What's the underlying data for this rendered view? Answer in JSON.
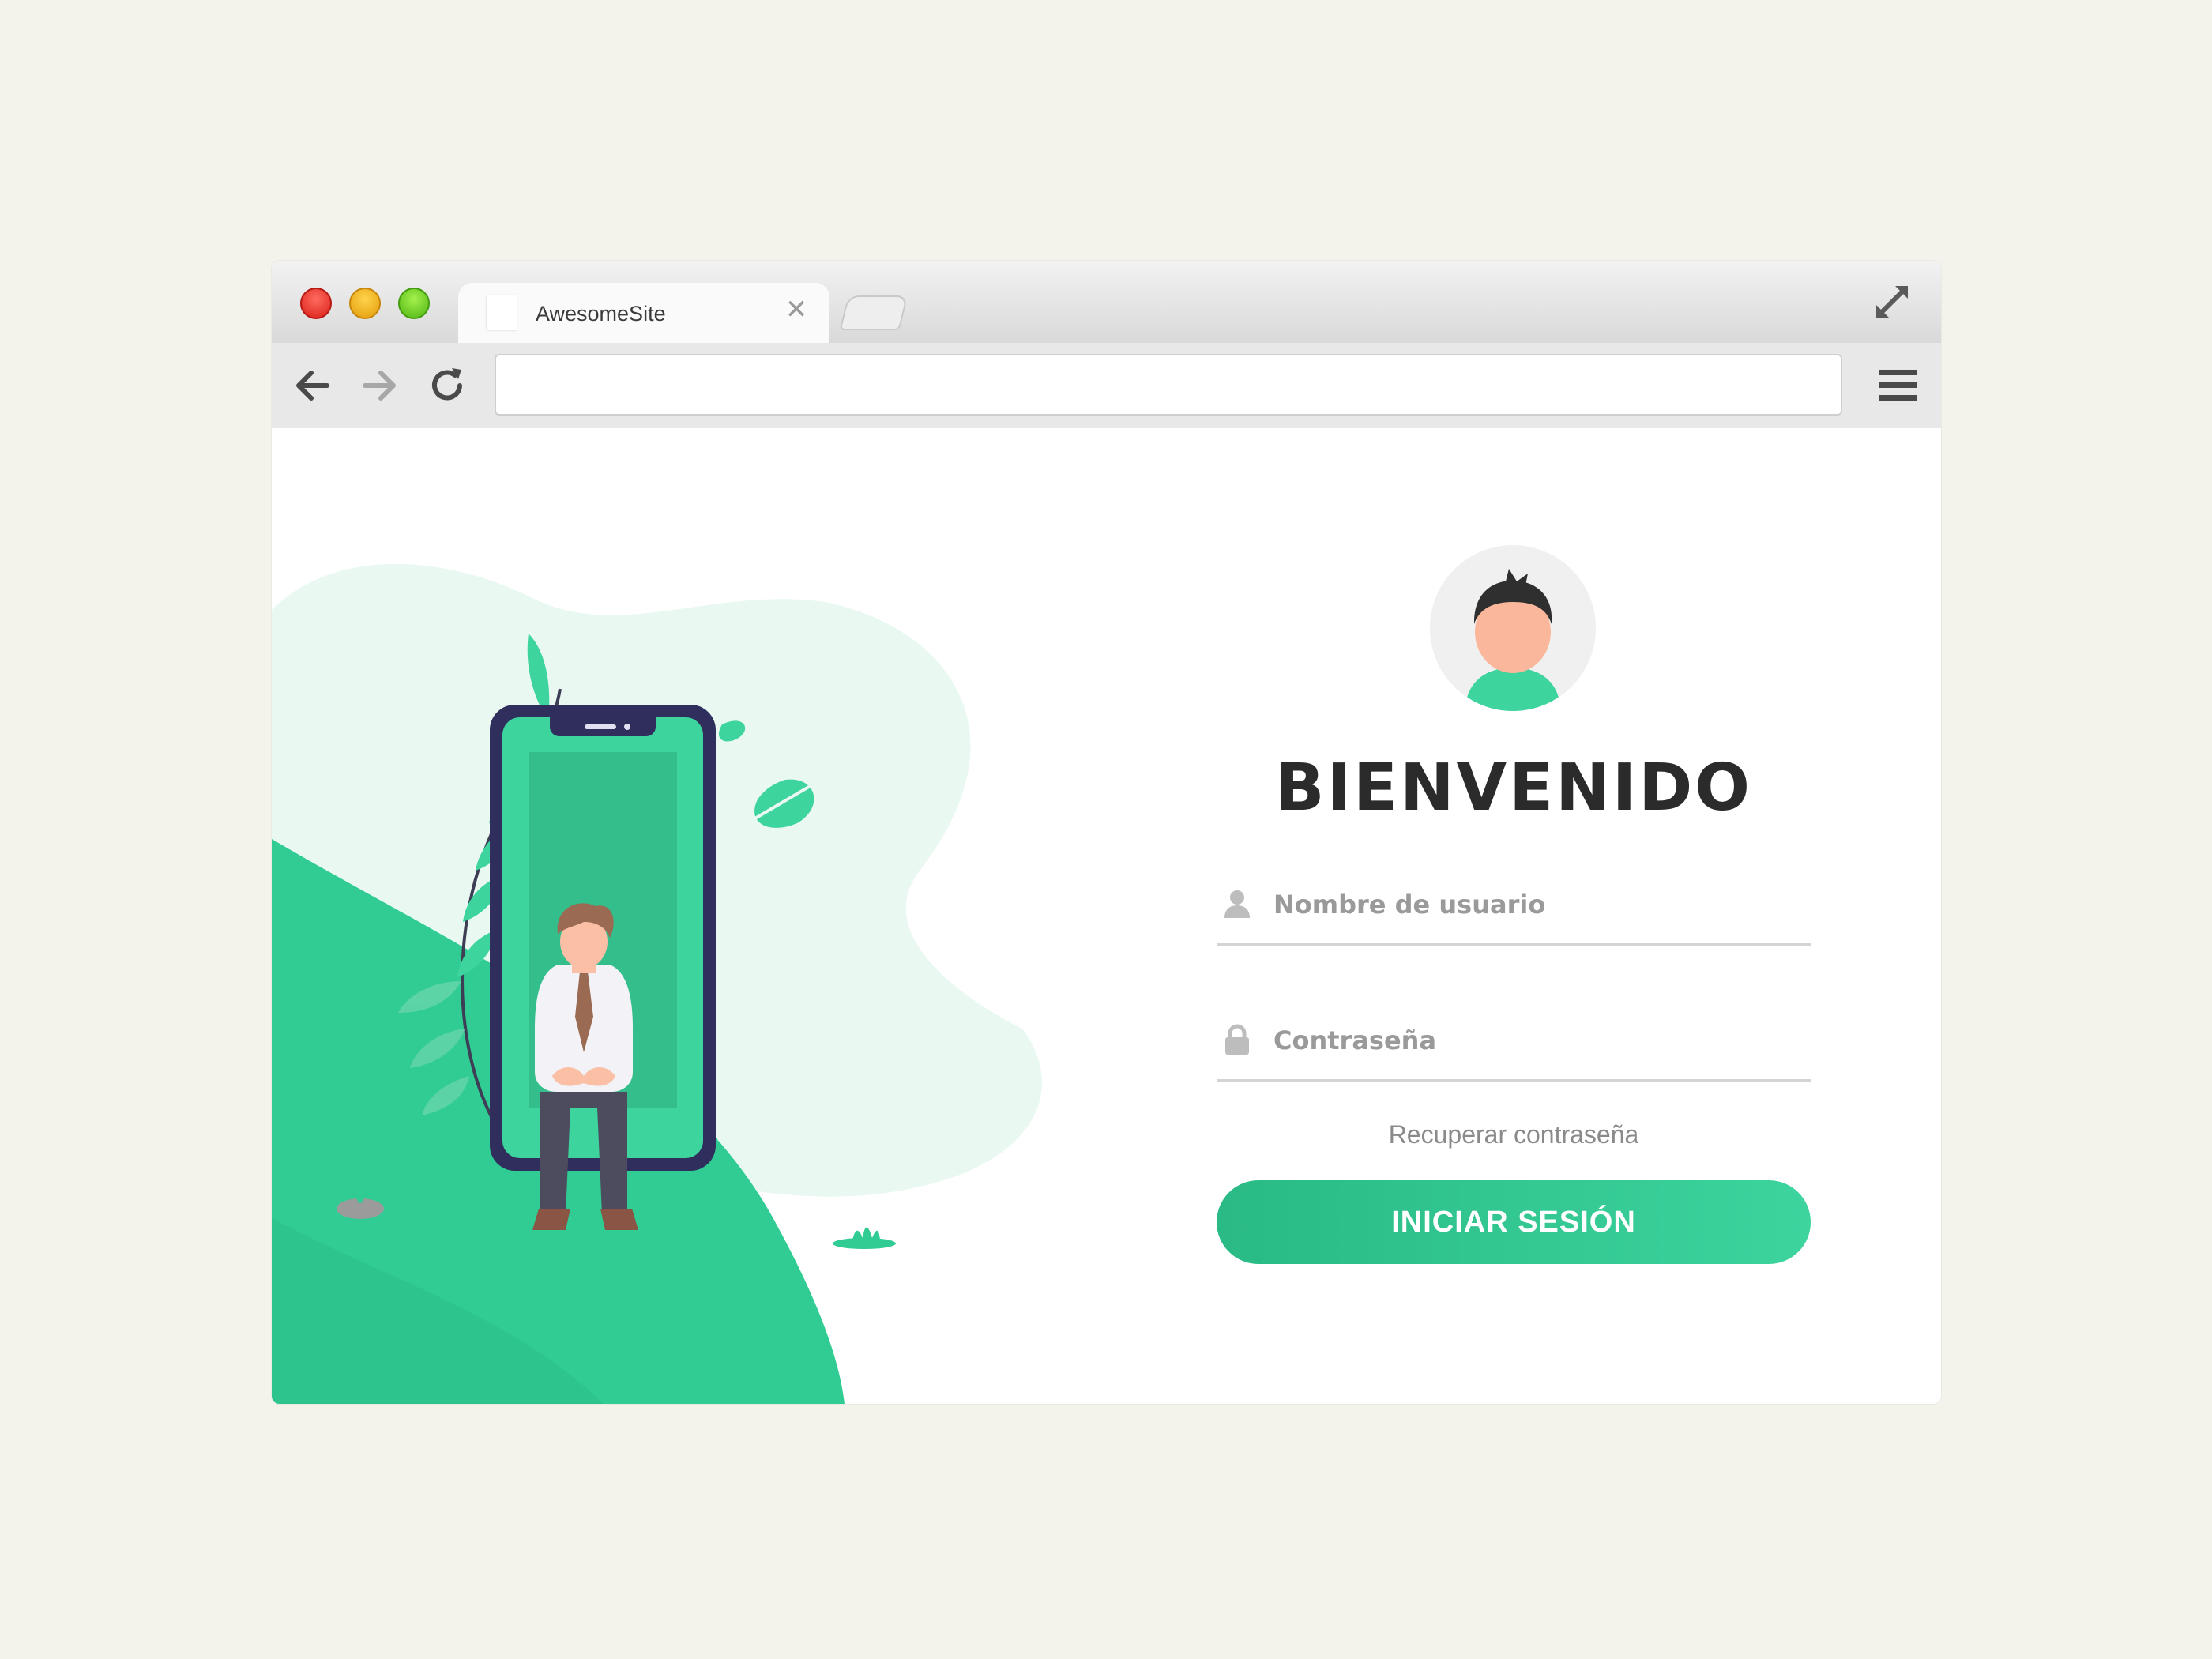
{
  "browser": {
    "tab_title": "AwesomeSite",
    "tab_close_glyph": "✕",
    "address_value": "",
    "icons": [
      "close-dot",
      "minimize-dot",
      "zoom-dot",
      "expand-icon",
      "back-arrow-icon",
      "forward-arrow-icon",
      "reload-icon",
      "hamburger-menu-icon"
    ]
  },
  "login": {
    "heading": "BIENVENIDO",
    "username_placeholder": "Nombre de usuario",
    "password_placeholder": "Contraseña",
    "recover_label": "Recuperar contraseña",
    "submit_label": "INICIAR SESIÓN"
  },
  "colors": {
    "page_background": "#f3f3ec",
    "accent_green": "#33cc95",
    "accent_green_dark": "#29ba85",
    "phone_frame": "#2f2e5c",
    "heading": "#2b2b2b"
  }
}
